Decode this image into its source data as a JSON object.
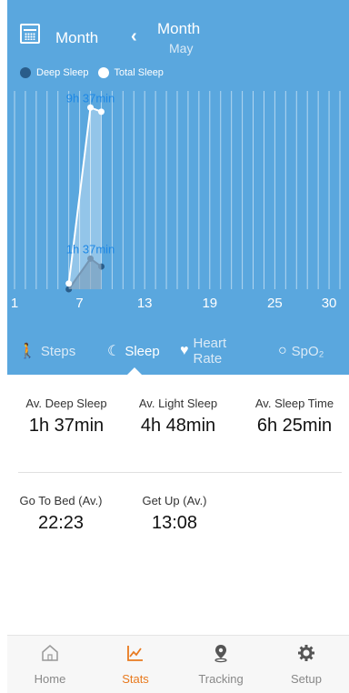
{
  "header": {
    "period_label": "Month",
    "range_title": "Month",
    "range_sub": "May"
  },
  "legend": [
    {
      "label": "Deep Sleep",
      "color": "#2a5d8a"
    },
    {
      "label": "Total Sleep",
      "color": "#ffffff"
    }
  ],
  "chart_data": {
    "type": "line",
    "x_ticks": [
      "1",
      "7",
      "13",
      "19",
      "25",
      "30"
    ],
    "xlim": [
      1,
      31
    ],
    "series": [
      {
        "name": "Deep Sleep",
        "color": "#2a5d8a",
        "points": [
          [
            6,
            0.0
          ],
          [
            8,
            1.62
          ],
          [
            9,
            1.2
          ]
        ]
      },
      {
        "name": "Total Sleep",
        "color": "#ffffff",
        "points": [
          [
            6,
            0.3
          ],
          [
            8,
            9.62
          ],
          [
            9,
            9.4
          ]
        ]
      }
    ],
    "annotations": [
      {
        "text": "9h 37min",
        "x": 8,
        "y": 9.62
      },
      {
        "text": "1h 37min",
        "x": 8,
        "y": 1.62
      }
    ]
  },
  "tabs": [
    {
      "label": "Steps",
      "icon": "walk-icon"
    },
    {
      "label": "Sleep",
      "icon": "moon-icon"
    },
    {
      "label": "Heart Rate",
      "icon": "heart-icon"
    },
    {
      "label": "SpO₂",
      "icon": "oxygen-icon"
    }
  ],
  "stats": {
    "deep_label": "Av. Deep Sleep",
    "deep_value": "1h 37min",
    "light_label": "Av. Light Sleep",
    "light_value": "4h 48min",
    "time_label": "Av. Sleep Time",
    "time_value": "6h 25min",
    "bed_label": "Go To Bed (Av.)",
    "bed_value": "22:23",
    "up_label": "Get Up (Av.)",
    "up_value": "13:08"
  },
  "nav": [
    {
      "label": "Home",
      "icon": "home-icon"
    },
    {
      "label": "Stats",
      "icon": "stats-icon"
    },
    {
      "label": "Tracking",
      "icon": "location-icon"
    },
    {
      "label": "Setup",
      "icon": "gear-icon"
    }
  ],
  "colors": {
    "accent": "#5aa7de",
    "active_nav": "#e87a1f"
  }
}
